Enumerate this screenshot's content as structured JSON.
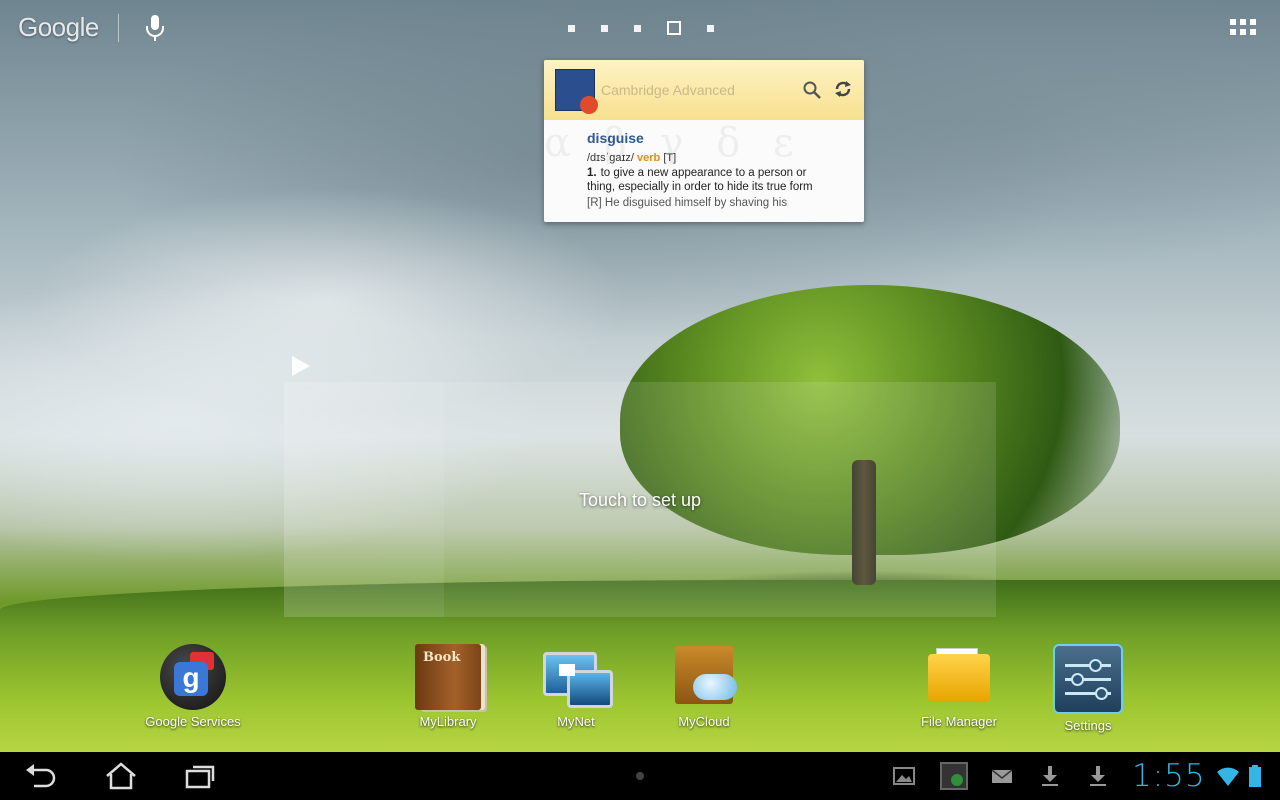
{
  "top_bar": {
    "google_text": "Google",
    "page_count": 5,
    "current_page": 4
  },
  "dictionary_widget": {
    "title": "Cambridge Advanced",
    "word": "disguise",
    "pronunciation": "/dɪsˈgaɪz/",
    "part_of_speech": "verb",
    "grammar": "[T]",
    "definition_number": "1.",
    "definition": "to give a new appearance to a person or thing, especially in order to hide its true form",
    "example_partial": "[R] He disguised himself by shaving his"
  },
  "setup_widget": {
    "text": "Touch to set up"
  },
  "dock": [
    {
      "label": "Google Services",
      "icon": "google-services-icon"
    },
    {
      "label": "MyLibrary",
      "icon": "book-icon"
    },
    {
      "label": "MyNet",
      "icon": "mynet-icon"
    },
    {
      "label": "MyCloud",
      "icon": "mycloud-icon"
    },
    {
      "label": "File Manager",
      "icon": "folder-icon"
    },
    {
      "label": "Settings",
      "icon": "settings-icon"
    }
  ],
  "status_bar": {
    "time": "1:55",
    "accent_color": "#33b5e5"
  }
}
